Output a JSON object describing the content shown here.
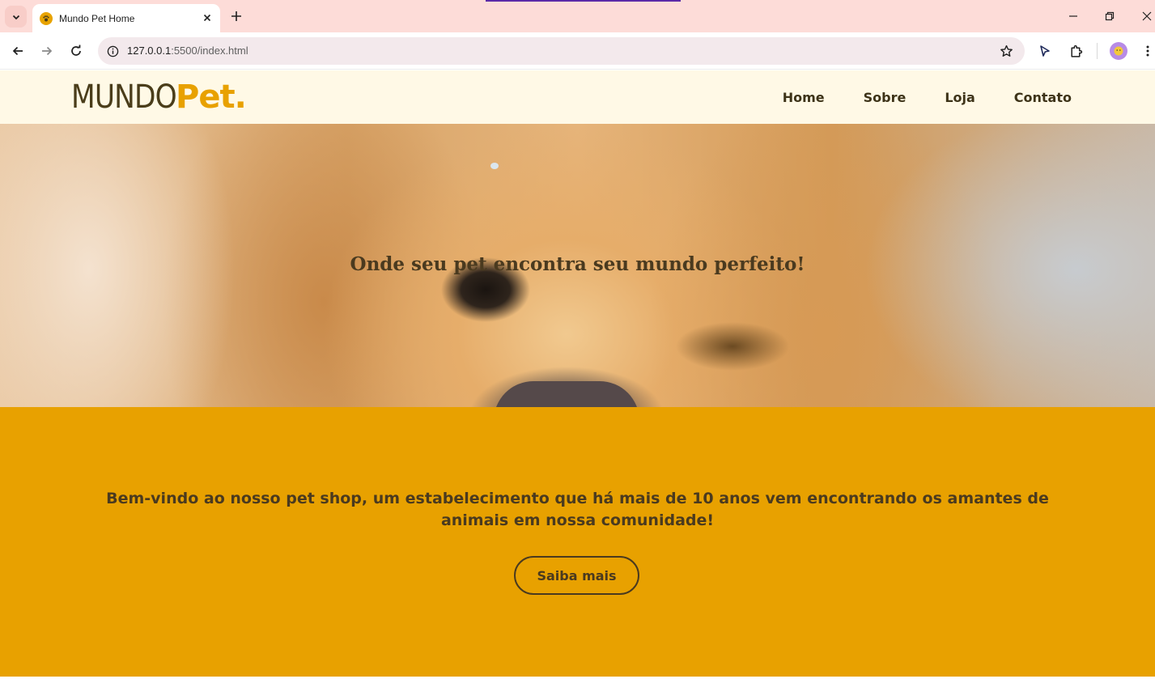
{
  "browser": {
    "tab_title": "Mundo Pet Home",
    "url_host": "127.0.0.1",
    "url_path": ":5500/index.html"
  },
  "site": {
    "logo_part1": "MUNDO",
    "logo_part2": "Pet.",
    "nav": [
      "Home",
      "Sobre",
      "Loja",
      "Contato"
    ],
    "hero_tagline": "Onde seu pet encontra seu mundo perfeito!",
    "welcome_text": "Bem-vindo ao nosso pet shop, um estabelecimento que há mais de 10 anos vem encontrando os amantes de animais em nossa comunidade!",
    "cta_label": "Saiba mais"
  },
  "colors": {
    "header_bg": "#fff9e6",
    "brand_dark": "#4a3d1a",
    "brand_accent": "#e8a100",
    "tabbar_bg": "#fddcd8"
  }
}
